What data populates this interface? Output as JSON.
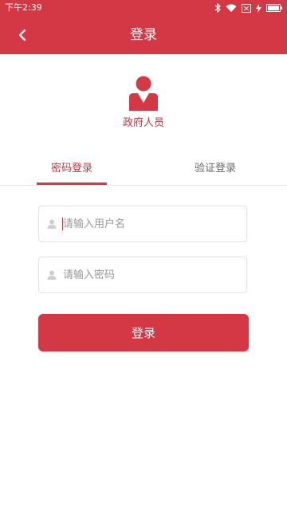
{
  "status_bar": {
    "time": "下午2:39",
    "icons": [
      "bluetooth-icon",
      "wifi-icon",
      "sim-icon",
      "charging-icon",
      "battery-icon"
    ]
  },
  "header": {
    "title": "登录",
    "back_icon": "chevron-left-icon"
  },
  "role": {
    "icon": "person-icon",
    "label": "政府人员"
  },
  "tabs": [
    {
      "label": "密码登录",
      "active": true
    },
    {
      "label": "验证登录",
      "active": false
    }
  ],
  "form": {
    "username": {
      "placeholder": "请输入用户名",
      "value": "",
      "icon": "user-icon"
    },
    "password": {
      "placeholder": "请输入密码",
      "value": "",
      "icon": "user-icon"
    }
  },
  "login_button": {
    "label": "登录"
  },
  "colors": {
    "primary": "#d43844",
    "text_active": "#c8333f",
    "text_muted": "#666666",
    "placeholder": "#999999",
    "border": "#e3e3e3"
  }
}
